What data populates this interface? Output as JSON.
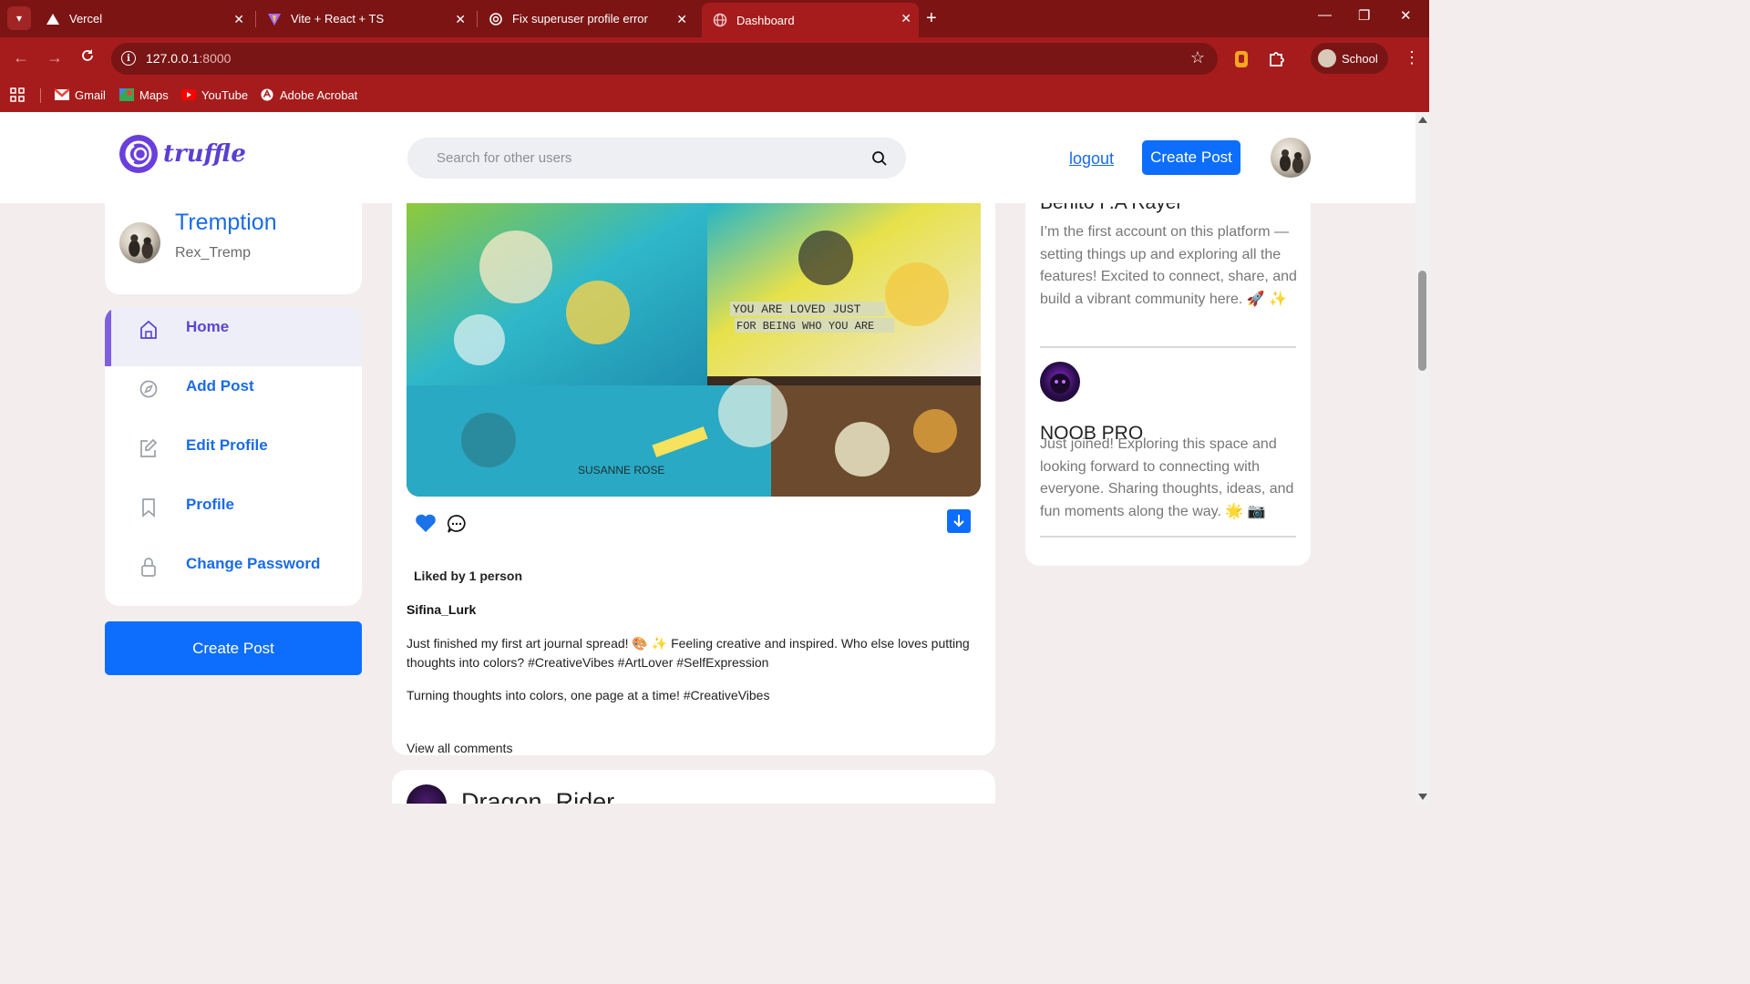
{
  "browser": {
    "tabs": [
      {
        "title": "Vercel",
        "icon": "vercel-icon"
      },
      {
        "title": "Vite + React + TS",
        "icon": "vite-icon"
      },
      {
        "title": "Fix superuser profile error",
        "icon": "openai-icon"
      },
      {
        "title": "Dashboard",
        "icon": "globe-icon",
        "active": true
      }
    ],
    "url_host": "127.0.0.1",
    "url_port": ":8000",
    "profile_label": "School",
    "bookmarks": [
      "Gmail",
      "Maps",
      "YouTube",
      "Adobe Acrobat"
    ]
  },
  "navbar": {
    "logo_text": "truffle",
    "search_placeholder": "Search for other users",
    "logout_label": "logout",
    "create_post_label": "Create Post"
  },
  "profile": {
    "display_name": "Tremption",
    "username": "Rex_Tremp"
  },
  "menu": [
    {
      "label": "Home",
      "icon": "home-icon",
      "active": true
    },
    {
      "label": "Add Post",
      "icon": "compass-icon"
    },
    {
      "label": "Edit Profile",
      "icon": "edit-icon"
    },
    {
      "label": "Profile",
      "icon": "bookmark-icon"
    },
    {
      "label": "Change Password",
      "icon": "lock-icon"
    }
  ],
  "sidebar_create_label": "Create Post",
  "post": {
    "image_text_1": "YOU ARE LOVED JUST",
    "image_text_2": "FOR BEING WHO YOU ARE",
    "image_text_3": "SUSANNE ROSE",
    "liked_by": "Liked by 1 person",
    "author": "Sifina_Lurk",
    "caption": "Just finished my first art journal spread! 🎨 ✨ Feeling creative and inspired. Who else loves putting thoughts into colors? #CreativeVibes #ArtLover #SelfExpression",
    "caption2": "Turning thoughts into colors, one page at a time! #CreativeVibes",
    "view_comments": "View all comments"
  },
  "next_post": {
    "author": "Dragon_Rider"
  },
  "suggested_users": [
    {
      "name": "Benito F.A Rayer",
      "bio": "I’m the first account on this platform — setting things up and exploring all the features! Excited to connect, share, and build a vibrant community here. 🚀 ✨"
    },
    {
      "name": "NOOB PRO",
      "bio": "Just joined! Exploring this space and looking forward to connecting with everyone. Sharing thoughts, ideas, and fun moments along the way. 🌟 📷"
    }
  ],
  "colors": {
    "accent": "#0d6efd",
    "brand": "#5b3fd0",
    "chrome": "#a61c1c"
  }
}
